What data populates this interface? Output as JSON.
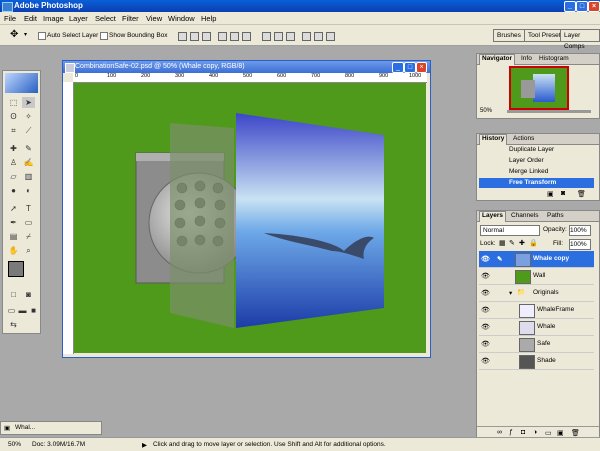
{
  "window": {
    "title": "Adobe Photoshop"
  },
  "menu": [
    "File",
    "Edit",
    "Image",
    "Layer",
    "Select",
    "Filter",
    "View",
    "Window",
    "Help"
  ],
  "options": {
    "auto_select": "Auto Select Layer",
    "bounding_box": "Show Bounding Box",
    "palette_tabs": [
      "Brushes",
      "Tool Presets",
      "Layer Comps"
    ]
  },
  "document": {
    "title": "CombinationSafe-02.psd @ 50% (Whale copy, RGB/8)",
    "ruler_ticks": [
      "0",
      "100",
      "200",
      "300",
      "400",
      "500",
      "600",
      "700",
      "800",
      "900",
      "1000"
    ]
  },
  "navigator": {
    "tabs": [
      "Navigator",
      "Info",
      "Histogram"
    ],
    "zoom": "50%"
  },
  "history": {
    "tabs": [
      "History",
      "Actions"
    ],
    "items": [
      "Duplicate Layer",
      "Layer Order",
      "Merge Linked",
      "Free Transform"
    ],
    "selected": 3
  },
  "layers": {
    "tabs": [
      "Layers",
      "Channels",
      "Paths"
    ],
    "blend_mode": "Normal",
    "opacity_label": "Opacity:",
    "opacity": "100%",
    "lock_label": "Lock:",
    "fill_label": "Fill:",
    "fill": "100%",
    "items": [
      {
        "name": "Whale copy",
        "selected": true
      },
      {
        "name": "Wall",
        "selected": false
      },
      {
        "name": "Originals",
        "selected": false
      },
      {
        "name": "WhaleFrame",
        "selected": false
      },
      {
        "name": "Whale",
        "selected": false
      },
      {
        "name": "Safe",
        "selected": false
      },
      {
        "name": "Shade",
        "selected": false
      }
    ]
  },
  "taskbar": {
    "item": "Whal..."
  },
  "status": {
    "zoom": "50%",
    "doc": "Doc: 3.09M/16.7M",
    "hint": "Click and drag to move layer or selection.  Use Shift and Alt for additional options."
  },
  "colors": {
    "accent": "#2a6ee0",
    "canvas_green": "#4f9a1a",
    "titlebar": "#0a5fd8"
  }
}
